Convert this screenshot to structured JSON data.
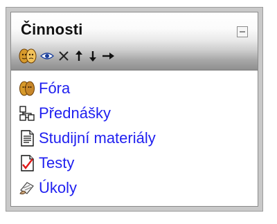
{
  "block": {
    "title": "Činnosti",
    "collapse_icon": "minus-box-icon",
    "toolbar_icons": [
      "roles-icon",
      "eye-icon",
      "delete-x-icon",
      "arrow-up-icon",
      "arrow-down-icon",
      "arrow-right-icon"
    ]
  },
  "activities": [
    {
      "label": "Fóra",
      "icon": "forum-icon"
    },
    {
      "label": "Přednášky",
      "icon": "resource-icon"
    },
    {
      "label": "Studijní materiály",
      "icon": "document-icon"
    },
    {
      "label": "Testy",
      "icon": "quiz-icon"
    },
    {
      "label": "Úkoly",
      "icon": "assignment-icon"
    }
  ],
  "colors": {
    "link": "#1f1ff0",
    "panel_border": "#c9c9c9"
  }
}
